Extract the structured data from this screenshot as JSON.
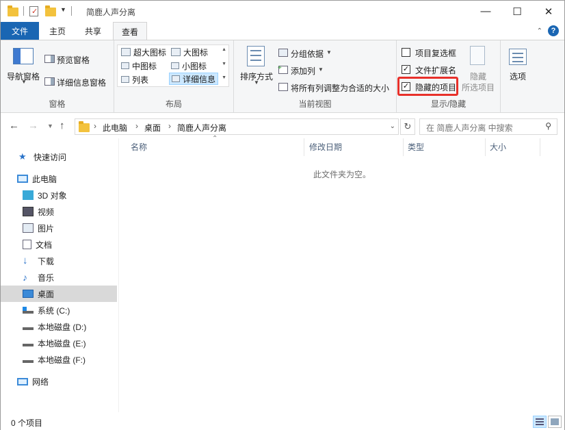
{
  "window": {
    "title": "简鹿人声分离"
  },
  "tabs": [
    {
      "label": "文件"
    },
    {
      "label": "主页"
    },
    {
      "label": "共享"
    },
    {
      "label": "查看"
    }
  ],
  "ribbon": {
    "panes": {
      "label": "窗格",
      "nav_pane": "导航窗格",
      "preview_pane": "预览窗格",
      "details_pane": "详细信息窗格"
    },
    "layout": {
      "label": "布局",
      "items": [
        "超大图标",
        "大图标",
        "中图标",
        "小图标",
        "列表",
        "详细信息"
      ]
    },
    "current_view": {
      "label": "当前视图",
      "sort": "排序方式",
      "group_by": "分组依据",
      "add_column": "添加列",
      "fit_columns": "将所有列调整为合适的大小"
    },
    "show_hide": {
      "label": "显示/隐藏",
      "item_checkboxes": "项目复选框",
      "item_checkboxes_checked": false,
      "file_extensions": "文件扩展名",
      "file_extensions_checked": true,
      "hidden_items": "隐藏的项目",
      "hidden_items_checked": true,
      "hide_selected_1": "隐藏",
      "hide_selected_2": "所选项目"
    },
    "options": {
      "label": "选项"
    }
  },
  "address": {
    "crumbs": [
      "此电脑",
      "桌面",
      "简鹿人声分离"
    ],
    "search_placeholder": "在 简鹿人声分离 中搜索"
  },
  "nav": {
    "quick_access": "快速访问",
    "this_pc": "此电脑",
    "items": [
      "3D 对象",
      "视频",
      "图片",
      "文档",
      "下载",
      "音乐",
      "桌面",
      "系统 (C:)",
      "本地磁盘 (D:)",
      "本地磁盘 (E:)",
      "本地磁盘 (F:)"
    ],
    "network": "网络"
  },
  "columns": [
    "名称",
    "修改日期",
    "类型",
    "大小"
  ],
  "content": {
    "empty_message": "此文件夹为空。"
  },
  "status": {
    "count": "0 个项目"
  }
}
